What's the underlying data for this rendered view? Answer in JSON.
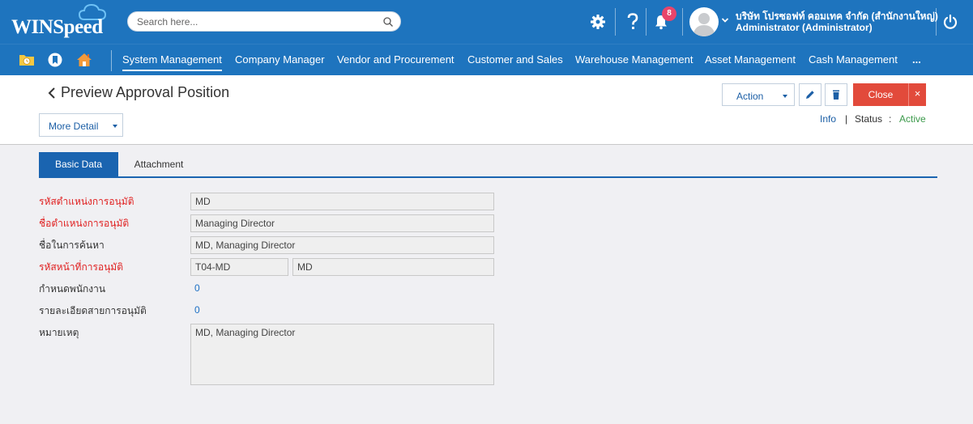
{
  "app": {
    "logo_text": "WINSpeed",
    "search_placeholder": "Search here...",
    "notification_count": "8",
    "company": "บริษัท โปรซอฟท์ คอมเทค จำกัด (สำนักงานใหญ่)",
    "user": "Administrator (Administrator)"
  },
  "header_icons": [
    "gear-icon",
    "help-icon",
    "bell-icon",
    "avatar",
    "power-icon"
  ],
  "nav": {
    "quick_icons": [
      "folder-clock-icon",
      "bookmark-icon",
      "home-icon"
    ],
    "items": [
      {
        "label": "System Management",
        "active": true
      },
      {
        "label": "Company Manager"
      },
      {
        "label": "Vendor and Procurement"
      },
      {
        "label": "Customer and Sales"
      },
      {
        "label": "Warehouse Management"
      },
      {
        "label": "Asset Management"
      },
      {
        "label": "Cash Management"
      },
      {
        "label": "..."
      }
    ]
  },
  "page": {
    "title": "Preview Approval Position",
    "more_detail": "More Detail",
    "action": "Action",
    "close": "Close",
    "close_x": "×",
    "info": "Info",
    "pipe": "|",
    "status_label": "Status",
    "status_colon": ":",
    "status_value": "Active"
  },
  "tabs": [
    "Basic Data",
    "Attachment"
  ],
  "form": {
    "position_code_label": "รหัสตำแหน่งการอนุมัติ",
    "position_code": "MD",
    "position_name_label": "ชื่อตำแหน่งการอนุมัติ",
    "position_name": "Managing Director",
    "search_name_label": "ชื่อในการค้นหา",
    "search_name": "MD, Managing Director",
    "duty_code_label": "รหัสหน้าที่การอนุมัติ",
    "duty_code": "T04-MD",
    "duty_name": "MD",
    "assign_employee_label": "กำหนดพนักงาน",
    "assign_employee_count": "0",
    "approval_line_label": "รายละเอียดสายการอนุมัติ",
    "approval_line_count": "0",
    "remark_label": "หมายเหตุ",
    "remark": "MD, Managing Director"
  },
  "colors": {
    "header_blue": "#1e74be",
    "tab_active": "#1a64b0",
    "close_red": "#e24a3b",
    "required_red": "#e02020",
    "active_green": "#3c9a4b",
    "badge_pink": "#e8456b"
  }
}
